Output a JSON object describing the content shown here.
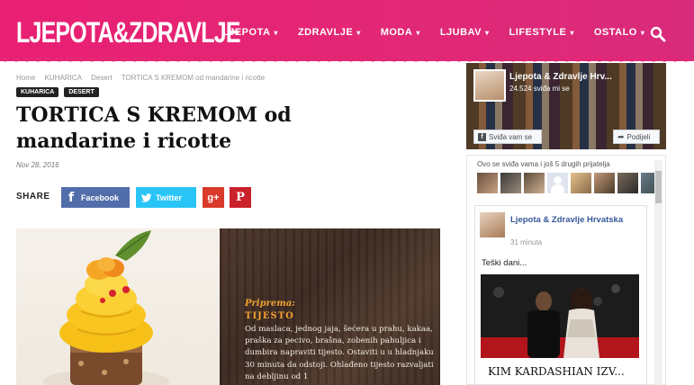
{
  "header": {
    "logo": "LJEPOTA&ZDRAVLJE",
    "nav": [
      {
        "label": "LJEPOTA",
        "dropdown": true
      },
      {
        "label": "ZDRAVLJE",
        "dropdown": true
      },
      {
        "label": "MODA",
        "dropdown": true
      },
      {
        "label": "LJUBAV",
        "dropdown": true
      },
      {
        "label": "LIFESTYLE",
        "dropdown": true
      },
      {
        "label": "OSTALO",
        "dropdown": true
      }
    ],
    "caret": "▾",
    "accent": "#e32775"
  },
  "breadcrumb": [
    "Home",
    "KUHARICA",
    "Desert",
    "TORTICA S KREMOM od mandarine i ricotte"
  ],
  "tags": [
    "KUHARICA",
    "DESERT"
  ],
  "article": {
    "title": "TORTICA S KREMOM od mandarine i ricotte",
    "date": "Nov 28, 2016"
  },
  "share": {
    "label": "SHARE",
    "facebook": "Facebook",
    "twitter": "Twitter",
    "gplus": "g+",
    "pinterest": "P"
  },
  "recipe": {
    "label": "Priprema:",
    "heading": "TIJESTO",
    "text": "Od maslaca, jednog jaja, šećera u prahu, kakaa, praška za pecivo, brašna, zobenih pahuljica i dumbira napraviti tijesto. Ostaviti u u hladnjaku 30 minuta da odstoji. Ohlađeno tijesto razvaljati na debljinu od 1"
  },
  "facebook_widget": {
    "page_name": "Ljepota & Zdravlje Hrv...",
    "likes": "24.524 sviđa mi se",
    "like_button": "Sviđa vam se",
    "share_button": "Podijeli",
    "friends_text": "Ovo se sviđa vama i još 5 drugih prijatelja",
    "post": {
      "author": "Ljepota & Zdravlje Hrvatska",
      "time": "31 minuta",
      "text": "Teški dani...",
      "headline": "KIM KARDASHIAN IZV..."
    }
  }
}
